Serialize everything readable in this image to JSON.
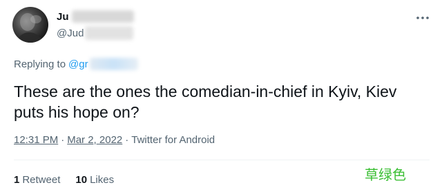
{
  "tweet": {
    "author_display_name": "Ju",
    "author_handle": "@Jud",
    "replying_prefix": "Replying to",
    "replying_handle": "@gr",
    "text": "These are the ones the comedian-in-chief in Kyiv, Kiev puts his hope on?",
    "time": "12:31 PM",
    "date": "Mar 2, 2022",
    "source": "Twitter for Android",
    "separator": "·"
  },
  "stats": {
    "retweets_count": "1",
    "retweets_label": "Retweet",
    "likes_count": "10",
    "likes_label": "Likes"
  },
  "icons": {
    "more": "more-dots-icon",
    "avatar": "profile-avatar"
  },
  "watermark": "草绿色",
  "colors": {
    "text_primary": "#0f1419",
    "text_secondary": "#536471",
    "link_blue": "#1d9bf0",
    "watermark_green": "#3bbf34"
  }
}
